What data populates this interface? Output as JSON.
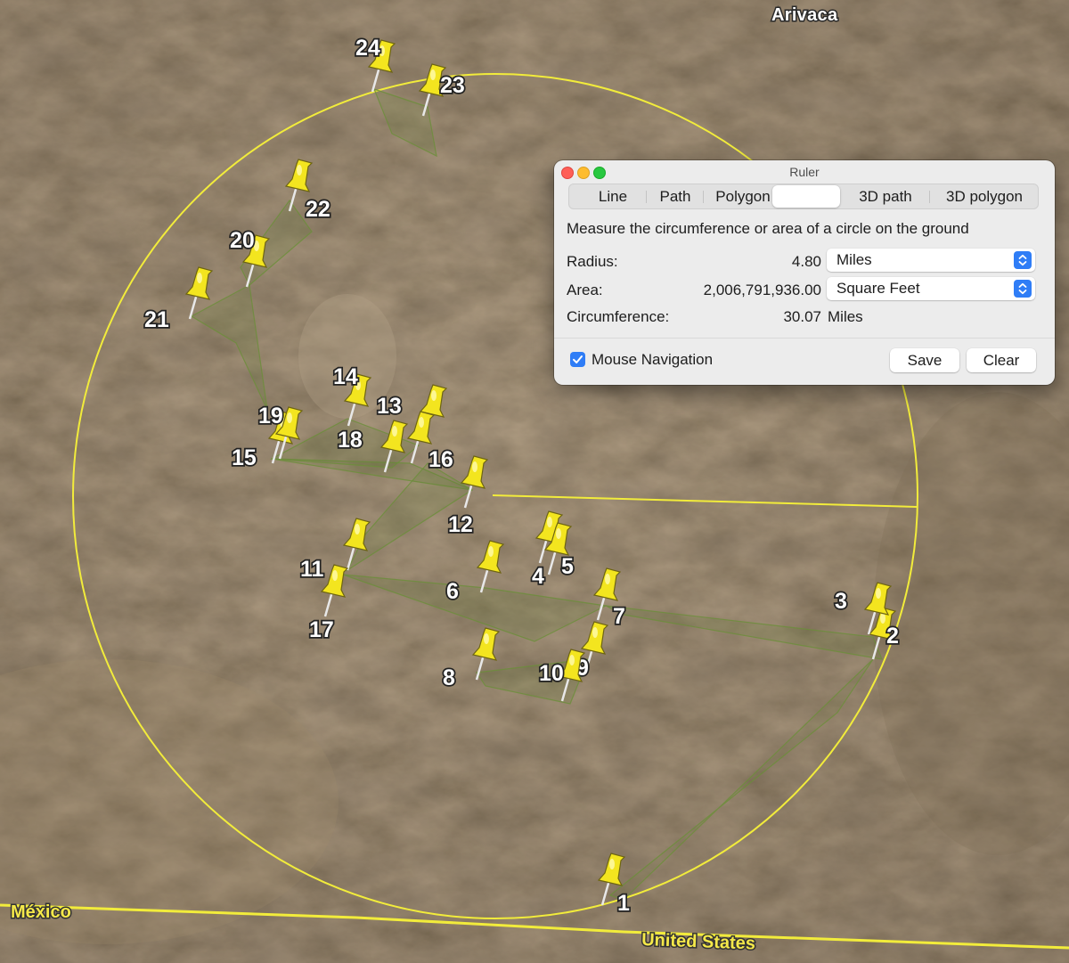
{
  "map": {
    "place_label": "Arivaca",
    "border_labels": {
      "mexico": "México",
      "united_states": "United States"
    },
    "colors": {
      "circle": "#f2ec3b",
      "pin": "#f3e51f",
      "path": "#6b8f3a",
      "border": "#f2ec3b"
    },
    "placemarks": [
      "1",
      "2",
      "3",
      "4",
      "5",
      "6",
      "7",
      "8",
      "9",
      "10",
      "11",
      "12",
      "13",
      "14",
      "15",
      "16",
      "17",
      "18",
      "19",
      "20",
      "21",
      "22",
      "23",
      "24"
    ]
  },
  "ruler": {
    "title": "Ruler",
    "tabs": [
      "Line",
      "Path",
      "Polygon",
      "",
      "3D path",
      "3D polygon"
    ],
    "active_tab_index": 3,
    "description": "Measure the circumference or area of a circle on the ground",
    "radius": {
      "label": "Radius:",
      "value": "4.80",
      "unit": "Miles"
    },
    "area": {
      "label": "Area:",
      "value": "2,006,791,936.00",
      "unit": "Square Feet"
    },
    "circumference": {
      "label": "Circumference:",
      "value": "30.07",
      "unit": "Miles"
    },
    "mouse_navigation": {
      "label": "Mouse Navigation",
      "checked": true
    },
    "buttons": {
      "save": "Save",
      "clear": "Clear"
    }
  }
}
